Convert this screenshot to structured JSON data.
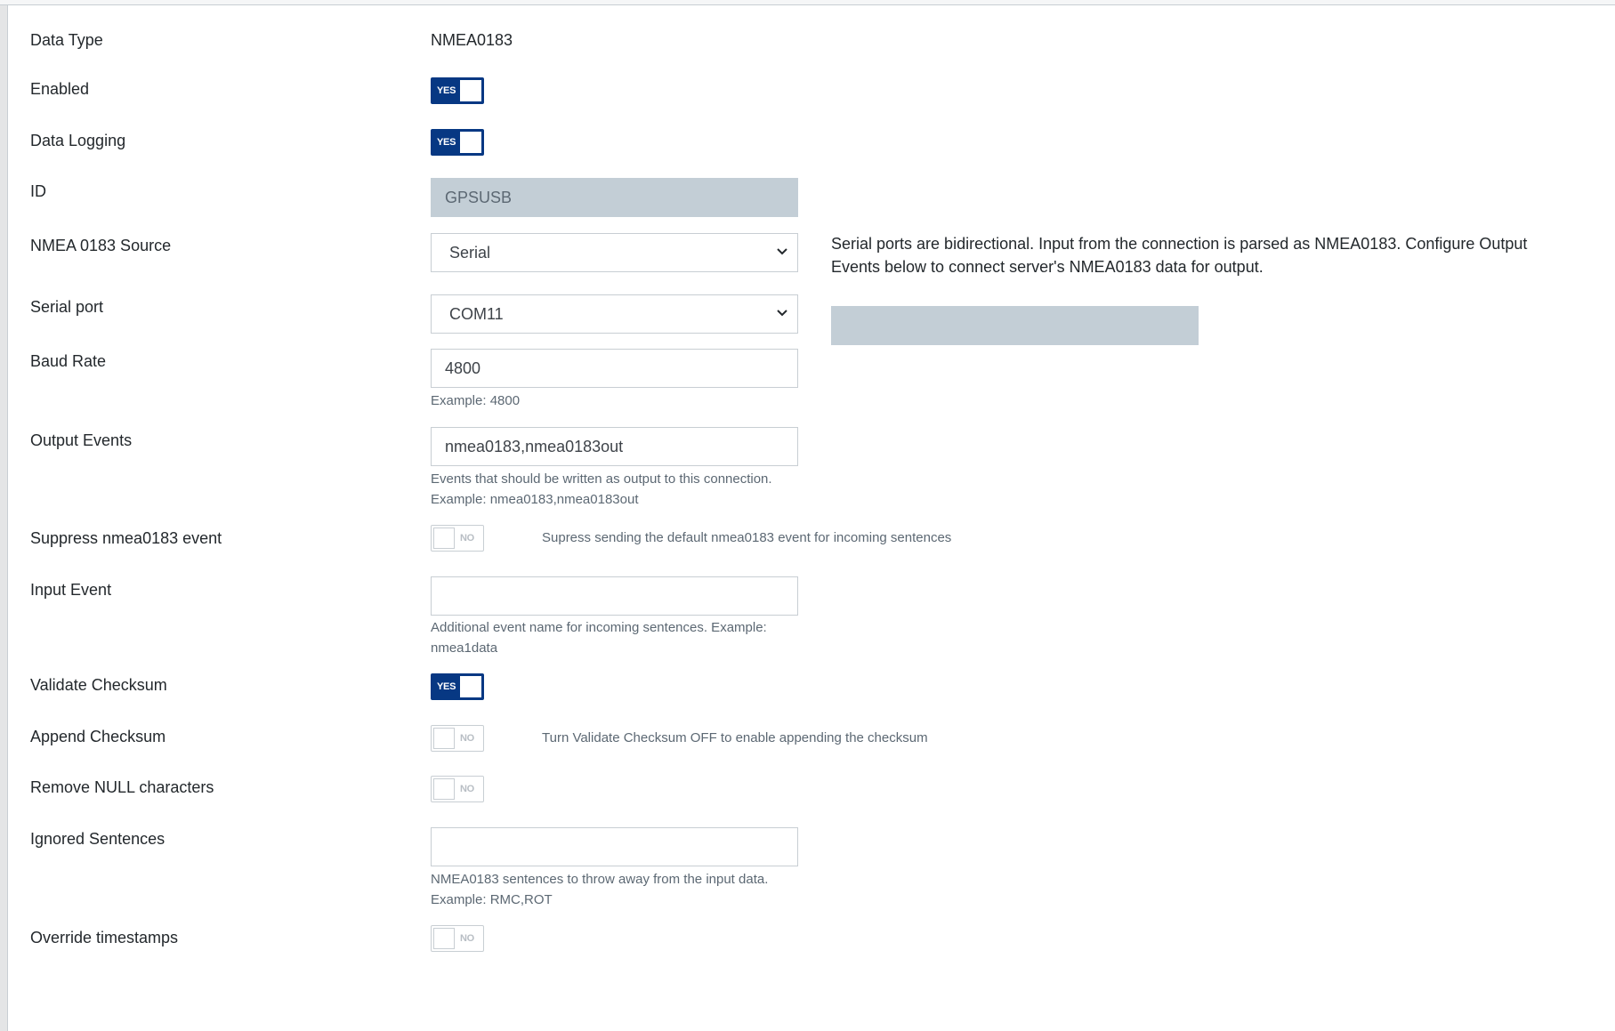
{
  "rows": {
    "data_type": {
      "label": "Data Type",
      "value": "NMEA0183"
    },
    "enabled": {
      "label": "Enabled",
      "toggle": "YES"
    },
    "data_logging": {
      "label": "Data Logging",
      "toggle": "YES"
    },
    "id": {
      "label": "ID",
      "value": "GPSUSB"
    },
    "source": {
      "label": "NMEA 0183 Source",
      "selected": "Serial",
      "description": "Serial ports are bidirectional. Input from the connection is parsed as NMEA0183. Configure Output Events below to connect server's NMEA0183 data for output."
    },
    "serial_port": {
      "label": "Serial port",
      "selected": "COM11"
    },
    "baud_rate": {
      "label": "Baud Rate",
      "value": "4800",
      "help": "Example: 4800"
    },
    "output_events": {
      "label": "Output Events",
      "value": "nmea0183,nmea0183out",
      "help_line1": "Events that should be written as output to this connection.",
      "help_line2": "Example: nmea0183,nmea0183out"
    },
    "suppress": {
      "label": "Suppress nmea0183 event",
      "toggle": "NO",
      "help": "Supress sending the default nmea0183 event for incoming sentences"
    },
    "input_event": {
      "label": "Input Event",
      "value": "",
      "help_line1": "Additional event name for incoming sentences. Example:",
      "help_line2": "nmea1data"
    },
    "validate_checksum": {
      "label": "Validate Checksum",
      "toggle": "YES"
    },
    "append_checksum": {
      "label": "Append Checksum",
      "toggle": "NO",
      "help": "Turn Validate Checksum OFF to enable appending the checksum"
    },
    "remove_null": {
      "label": "Remove NULL characters",
      "toggle": "NO"
    },
    "ignored_sentences": {
      "label": "Ignored Sentences",
      "value": "",
      "help_line1": "NMEA0183 sentences to throw away from the input data.",
      "help_line2": "Example: RMC,ROT"
    },
    "override_timestamps": {
      "label": "Override timestamps",
      "toggle": "NO"
    }
  },
  "colors": {
    "toggle_on": "#073883",
    "disabled_field": "#c3ced6",
    "border": "#c8ced3"
  },
  "icons": {
    "select_arrow": "chevron-down-icon"
  }
}
